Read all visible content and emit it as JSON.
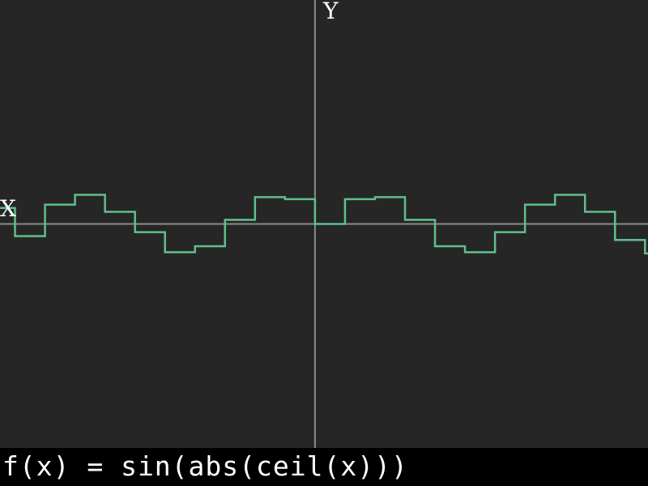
{
  "formula": "f(x) = sin(abs(ceil(x)))",
  "axes": {
    "x_label": "X",
    "y_label": "Y"
  },
  "colors": {
    "background": "#262626",
    "axis": "#8c8c8c",
    "curve": "#5fbf8c",
    "text": "#ffffff",
    "formula_bar": "#000000"
  },
  "chart_data": {
    "type": "line",
    "title": "",
    "expression": "sin(abs(ceil(x)))",
    "xlim": [
      -10.5,
      11.1
    ],
    "ylim": [
      -7.6,
      7.6
    ],
    "grid": false,
    "series": [
      {
        "x": [
          -11,
          -10,
          -10,
          -9,
          -9,
          -8,
          -8,
          -7,
          -7,
          -6,
          -6,
          -5,
          -5,
          -4,
          -4,
          -3,
          -3,
          -2,
          -2,
          -1,
          -1,
          0,
          0,
          1,
          1,
          2,
          2,
          3,
          3,
          4,
          4,
          5,
          5,
          6,
          6,
          7,
          7,
          8,
          8,
          9,
          9,
          10,
          10,
          11,
          11,
          12
        ],
        "y": [
          0.544,
          0.544,
          -0.412,
          -0.412,
          0.657,
          0.657,
          0.989,
          0.989,
          0.412,
          0.412,
          -0.279,
          -0.279,
          -0.959,
          -0.959,
          -0.757,
          -0.757,
          0.141,
          0.141,
          0.909,
          0.909,
          0.841,
          0.841,
          0,
          0,
          0.841,
          0.841,
          0.909,
          0.909,
          0.141,
          0.141,
          -0.757,
          -0.757,
          -0.959,
          -0.959,
          -0.279,
          -0.279,
          0.657,
          0.657,
          0.989,
          0.989,
          0.412,
          0.412,
          -0.544,
          -0.544,
          -1.0,
          -1.0
        ]
      }
    ]
  }
}
